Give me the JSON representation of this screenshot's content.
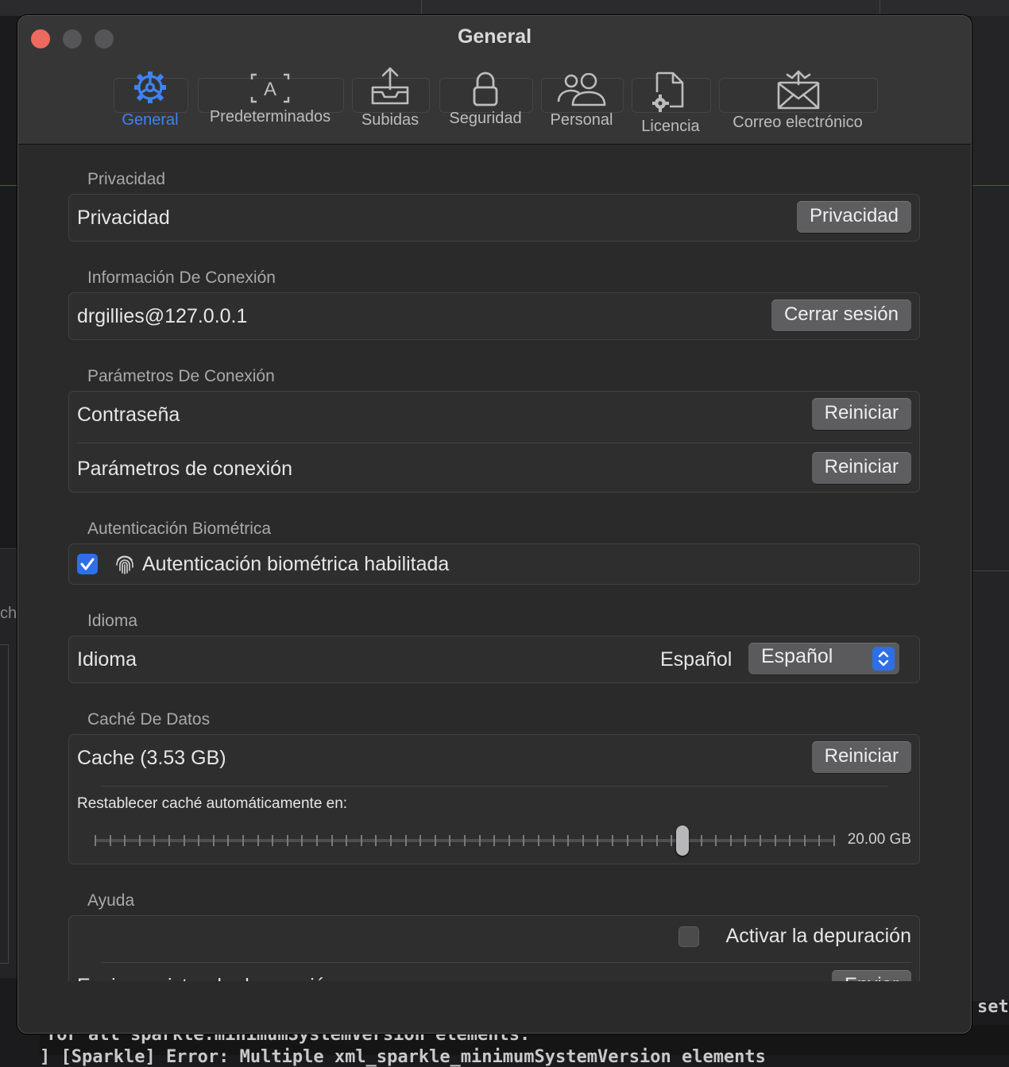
{
  "window": {
    "title": "General"
  },
  "toolbar": {
    "tabs": [
      {
        "label": "General",
        "icon": "gear-icon"
      },
      {
        "label": "Predeterminados",
        "icon": "text-a-icon"
      },
      {
        "label": "Subidas",
        "icon": "upload-tray-icon"
      },
      {
        "label": "Seguridad",
        "icon": "lock-icon"
      },
      {
        "label": "Personal",
        "icon": "people-icon"
      },
      {
        "label": "Licencia",
        "icon": "document-gear-icon"
      },
      {
        "label": "Correo electrónico",
        "icon": "envelope-icon"
      }
    ],
    "active": "General",
    "accent_color": "#3d83f5"
  },
  "privacy": {
    "section_title": "Privacidad",
    "row_label": "Privacidad",
    "button": "Privacidad"
  },
  "connection_info": {
    "section_title": "Información De Conexión",
    "account": "drgillies@127.0.0.1",
    "button": "Cerrar sesión"
  },
  "connection_params": {
    "section_title": "Parámetros De Conexión",
    "rows": [
      {
        "label": "Contraseña",
        "button": "Reiniciar"
      },
      {
        "label": "Parámetros de conexión",
        "button": "Reiniciar"
      }
    ]
  },
  "biometric": {
    "section_title": "Autenticación Biométrica",
    "checkbox_label": "Autenticación biométrica habilitada",
    "checked": true,
    "icon": "fingerprint-icon"
  },
  "language": {
    "section_title": "Idioma",
    "row_label": "Idioma",
    "current_value": "Español",
    "selected": "Español"
  },
  "cache": {
    "section_title": "Caché De Datos",
    "row_label": "Cache (3.53 GB)",
    "button": "Reiniciar",
    "auto_reset_label": "Restablecer caché automáticamente en:",
    "slider_value_label": "20.00 GB",
    "slider_position": 0.795
  },
  "help": {
    "section_title": "Ayuda",
    "debug_checkbox_label": "Activar la depuración",
    "debug_checked": false,
    "next_row_label": "Enviar registro de depuración",
    "next_row_button": "Enviar"
  },
  "background": {
    "terminal_line_1": "for all sparkle:minimumSystemVersion elements.",
    "terminal_line_2": "] [Sparkle] Error: Multiple xml_sparkle_minimumSystemVersion elements",
    "terminal_right": "set",
    "left_text": "ch"
  }
}
